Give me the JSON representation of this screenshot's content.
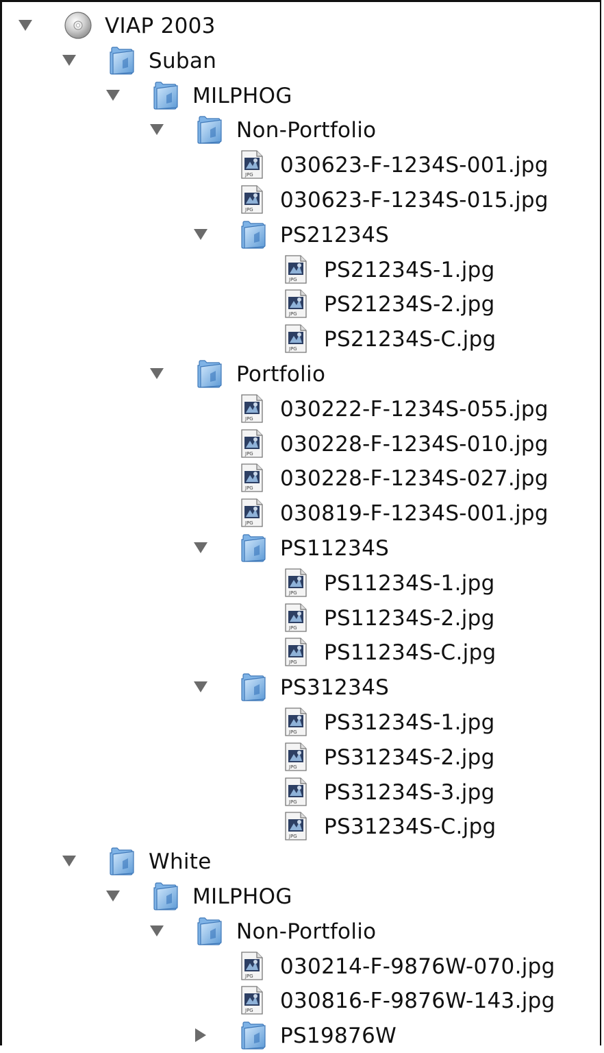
{
  "tree": [
    {
      "label": "VIAP 2003",
      "level": 0,
      "type": "disc",
      "expanded": true
    },
    {
      "label": "Suban",
      "level": 1,
      "type": "folder",
      "expanded": true
    },
    {
      "label": "MILPHOG",
      "level": 2,
      "type": "folder",
      "expanded": true
    },
    {
      "label": "Non-Portfolio",
      "level": 3,
      "type": "folder",
      "expanded": true
    },
    {
      "label": "030623-F-1234S-001.jpg",
      "level": 4,
      "type": "file"
    },
    {
      "label": "030623-F-1234S-015.jpg",
      "level": 4,
      "type": "file"
    },
    {
      "label": "PS21234S",
      "level": 4,
      "type": "folder",
      "expanded": true
    },
    {
      "label": "PS21234S-1.jpg",
      "level": 5,
      "type": "file"
    },
    {
      "label": "PS21234S-2.jpg",
      "level": 5,
      "type": "file"
    },
    {
      "label": "PS21234S-C.jpg",
      "level": 5,
      "type": "file"
    },
    {
      "label": "Portfolio",
      "level": 3,
      "type": "folder",
      "expanded": true
    },
    {
      "label": "030222-F-1234S-055.jpg",
      "level": 4,
      "type": "file"
    },
    {
      "label": "030228-F-1234S-010.jpg",
      "level": 4,
      "type": "file"
    },
    {
      "label": "030228-F-1234S-027.jpg",
      "level": 4,
      "type": "file"
    },
    {
      "label": "030819-F-1234S-001.jpg",
      "level": 4,
      "type": "file"
    },
    {
      "label": "PS11234S",
      "level": 4,
      "type": "folder",
      "expanded": true
    },
    {
      "label": "PS11234S-1.jpg",
      "level": 5,
      "type": "file"
    },
    {
      "label": "PS11234S-2.jpg",
      "level": 5,
      "type": "file"
    },
    {
      "label": "PS11234S-C.jpg",
      "level": 5,
      "type": "file"
    },
    {
      "label": "PS31234S",
      "level": 4,
      "type": "folder",
      "expanded": true
    },
    {
      "label": "PS31234S-1.jpg",
      "level": 5,
      "type": "file"
    },
    {
      "label": "PS31234S-2.jpg",
      "level": 5,
      "type": "file"
    },
    {
      "label": "PS31234S-3.jpg",
      "level": 5,
      "type": "file"
    },
    {
      "label": "PS31234S-C.jpg",
      "level": 5,
      "type": "file"
    },
    {
      "label": "White",
      "level": 1,
      "type": "folder",
      "expanded": true
    },
    {
      "label": "MILPHOG",
      "level": 2,
      "type": "folder",
      "expanded": true
    },
    {
      "label": "Non-Portfolio",
      "level": 3,
      "type": "folder",
      "expanded": true
    },
    {
      "label": "030214-F-9876W-070.jpg",
      "level": 4,
      "type": "file"
    },
    {
      "label": "030816-F-9876W-143.jpg",
      "level": 4,
      "type": "file"
    },
    {
      "label": "PS19876W",
      "level": 4,
      "type": "folder",
      "expanded": false
    }
  ],
  "icons": {
    "disc": "cd-disc-icon",
    "folder": "folder-icon",
    "file": "jpeg-file-icon",
    "expanded": "disclosure-triangle-down-icon",
    "collapsed": "disclosure-triangle-right-icon"
  },
  "colors": {
    "triangle": "#6b6b6b",
    "folder_light": "#cfe6fb",
    "folder_dark": "#5d9ad6",
    "text": "#111111"
  }
}
